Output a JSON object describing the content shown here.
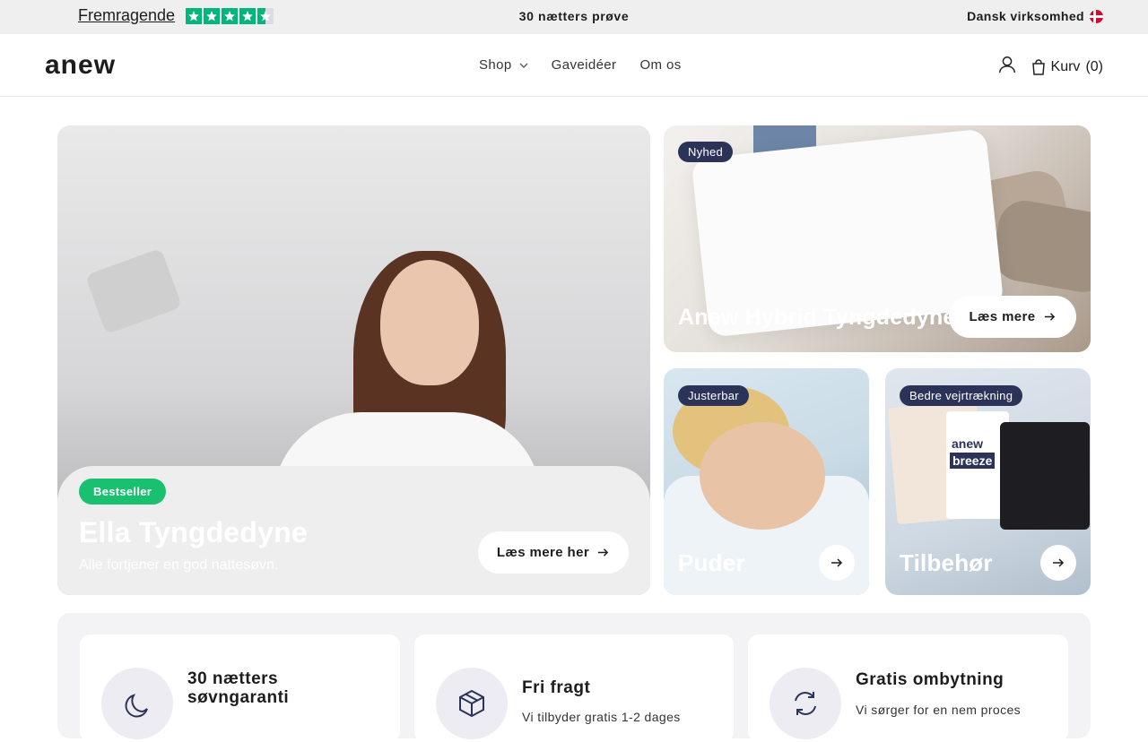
{
  "topbar": {
    "rating_text": "Fremragende",
    "stars_full": 4,
    "stars_half": 1,
    "center_text": "30 nætters prøve",
    "right_text": "Dansk virksomhed"
  },
  "header": {
    "logo": "anew",
    "nav": [
      {
        "label": "Shop"
      },
      {
        "label": "Gaveidéer"
      },
      {
        "label": "Om os"
      }
    ],
    "cart_label": "Kurv",
    "cart_count": "(0)"
  },
  "cards": {
    "main": {
      "badge": "Bestseller",
      "title": "Ella Tyngdedyne",
      "subtitle": "Alle fortjener en god nattesøvn.",
      "button": "Læs mere her"
    },
    "hybrid": {
      "badge": "Nyhed",
      "title": "Anew Hybrid Tyngdedyne",
      "button": "Læs mere"
    },
    "puder": {
      "badge": "Justerbar",
      "title": "Puder"
    },
    "tilbehor": {
      "badge": "Bedre vejrtrækning",
      "title": "Tilbehør",
      "product_text_1": "anew",
      "product_text_2": "breeze"
    }
  },
  "features": [
    {
      "title": "30 nætters søvngaranti",
      "desc": ""
    },
    {
      "title": "Fri fragt",
      "desc": "Vi tilbyder gratis 1-2 dages"
    },
    {
      "title": "Gratis ombytning",
      "desc": "Vi sørger for en nem proces"
    }
  ],
  "colors": {
    "accent_green": "#18c070",
    "badge_navy": "#2c3358",
    "trustpilot_green": "#00b67a"
  }
}
